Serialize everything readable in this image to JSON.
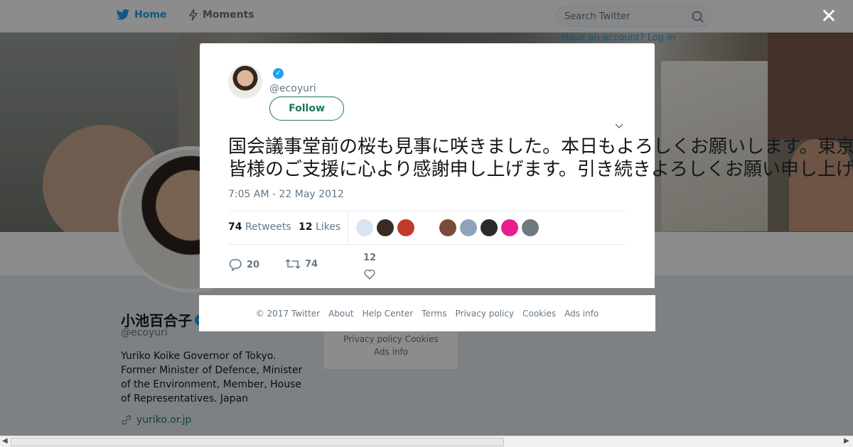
{
  "nav": {
    "home_label": "Home",
    "moments_label": "Moments",
    "search_placeholder": "Search Twitter",
    "login_text": "Have an account? Log in"
  },
  "profile": {
    "name": "小池百合子",
    "handle": "@ecoyuri",
    "bio": "Yuriko Koike Governor of Tokyo. Former Minister of Defence, Minister of the Environment, Member, House of Representatives. Japan",
    "link": "yuriko.or.jp",
    "footer_line1": "Privacy policy   Cookies",
    "footer_line2": "Ads info"
  },
  "tweet": {
    "handle": "@ecoyuri",
    "follow_label": "Follow",
    "text": "国会議事堂前の桜も見事に咲きました。本日もよろしくお願いします。東京の未来のために全力を尽くします。 今日も頑張ります。",
    "text_line2": "皆様のご支援に心より感謝申し上げます。引き続きよろしくお願い申し上げます。",
    "timestamp": "7:05 AM - 22 May 2012",
    "retweets_count": "74",
    "retweets_label": "Retweets",
    "likes_count": "12",
    "likes_label": "Likes",
    "reply_count": "20",
    "retweet_action_count": "74",
    "like_action_count": "12"
  },
  "faces": [
    "#d9e4f0",
    "#3a2c24",
    "#c0392b",
    "#7b4b3a",
    "#8fa3b8",
    "#2b2b2b",
    "#e91e8c",
    "#6d7a80"
  ],
  "footer": {
    "copyright": "© 2017 Twitter",
    "about": "About",
    "help": "Help Center",
    "terms": "Terms",
    "privacy": "Privacy policy",
    "cookies": "Cookies",
    "ads": "Ads info"
  },
  "colors": {
    "accent": "#1da1f2",
    "follow": "#1b7a55"
  }
}
